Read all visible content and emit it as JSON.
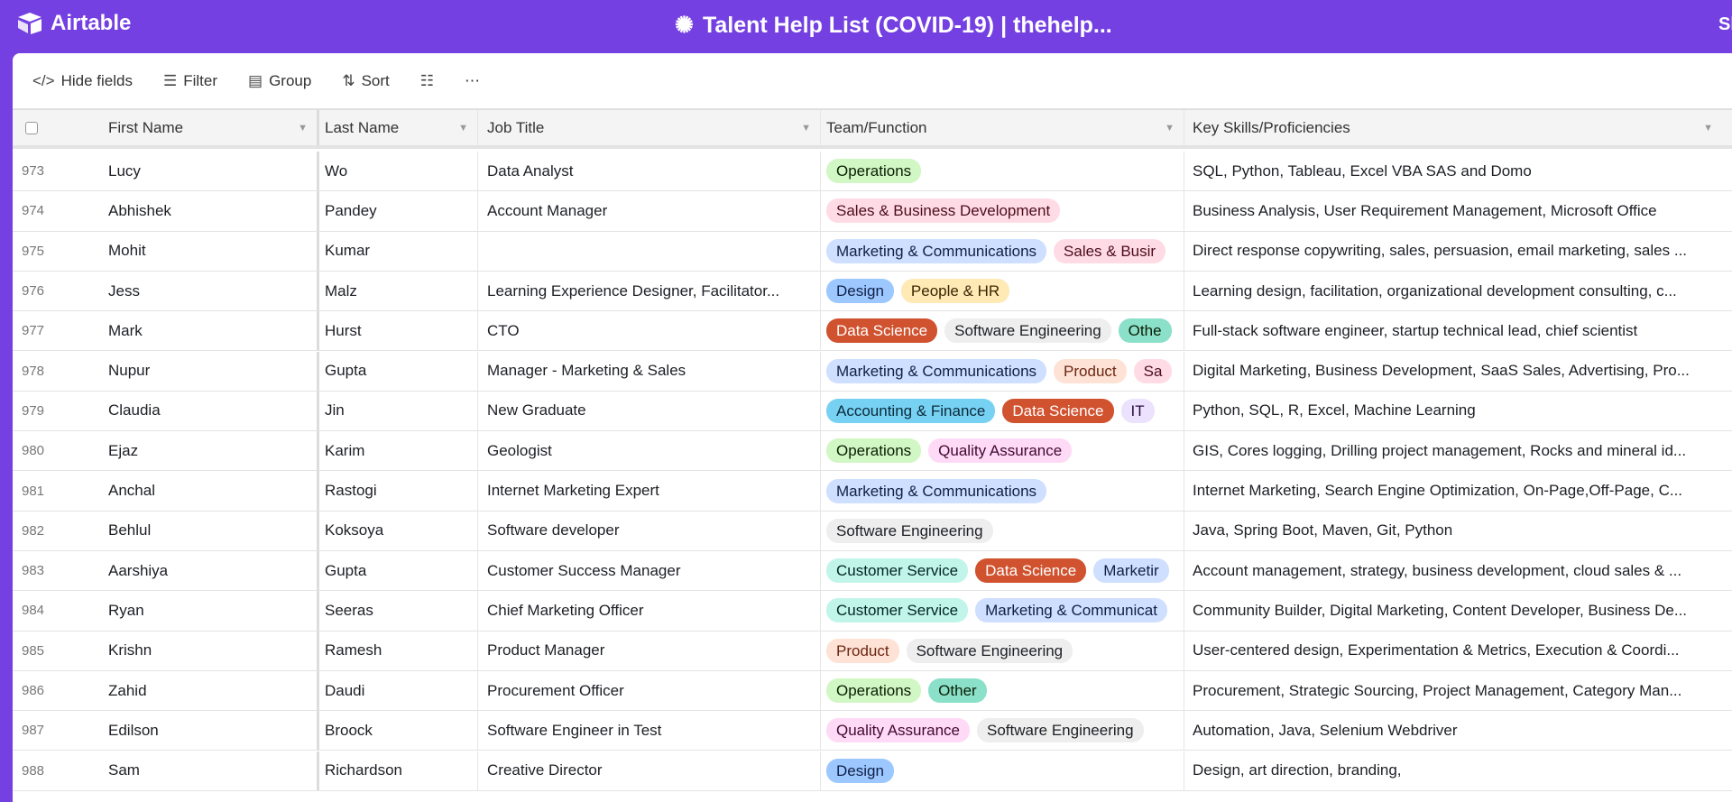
{
  "app": {
    "name": "Airtable",
    "title": "Talent Help List (COVID-19) | thehelp...",
    "share_label": "Sh"
  },
  "toolbar": {
    "hide_fields": "Hide fields",
    "filter": "Filter",
    "group": "Group",
    "sort": "Sort",
    "more": "⋯"
  },
  "columns": [
    "First Name",
    "Last Name",
    "Job Title",
    "Team/Function",
    "Key Skills/Proficiencies"
  ],
  "tag_colors": {
    "Operations": [
      "#d1f7c4",
      "#0b1d05"
    ],
    "Sales & Business Development": [
      "#ffdce5",
      "#4c0c1c"
    ],
    "Sales & Busir": [
      "#ffdce5",
      "#4c0c1c"
    ],
    "Sa": [
      "#ffdce5",
      "#4c0c1c"
    ],
    "Marketing & Communications": [
      "#cfdfff",
      "#102046"
    ],
    "Marketing & Communicat": [
      "#cfdfff",
      "#102046"
    ],
    "Marketir": [
      "#cfdfff",
      "#102046"
    ],
    "Design": [
      "#9cc7ff",
      "#102046"
    ],
    "People & HR": [
      "#ffeab6",
      "#3b2501"
    ],
    "Data Science": [
      "#d0522f",
      "#ffffff"
    ],
    "Software Engineering": [
      "#eeeeee",
      "#1d1f25"
    ],
    "Othe": [
      "#8ae0c9",
      "#0b1d05"
    ],
    "Other": [
      "#8ae0c9",
      "#0b1d05"
    ],
    "Product": [
      "#fee2d5",
      "#6b2613"
    ],
    "Accounting & Finance": [
      "#77d1f3",
      "#0b2a3a"
    ],
    "IT": [
      "#ede2fe",
      "#280b42"
    ],
    "Quality Assurance": [
      "#ffdaf6",
      "#400832"
    ],
    "Customer Service": [
      "#c2f5e9",
      "#012524"
    ]
  },
  "rows": [
    {
      "n": "973",
      "first": "Lucy",
      "last": "Wo",
      "job": "Data Analyst",
      "teams": [
        "Operations"
      ],
      "skills": "SQL, Python, Tableau, Excel VBA SAS and Domo"
    },
    {
      "n": "974",
      "first": "Abhishek",
      "last": "Pandey",
      "job": "Account Manager",
      "teams": [
        "Sales & Business Development"
      ],
      "skills": "Business Analysis, User Requirement Management, Microsoft Office"
    },
    {
      "n": "975",
      "first": "Mohit",
      "last": "Kumar",
      "job": "",
      "teams": [
        "Marketing & Communications",
        "Sales & Busir"
      ],
      "skills": "Direct response copywriting, sales, persuasion, email marketing, sales ..."
    },
    {
      "n": "976",
      "first": "Jess",
      "last": "Malz",
      "job": "Learning Experience Designer, Facilitator...",
      "teams": [
        "Design",
        "People & HR"
      ],
      "skills": "Learning design, facilitation, organizational development consulting, c..."
    },
    {
      "n": "977",
      "first": "Mark",
      "last": "Hurst",
      "job": "CTO",
      "teams": [
        "Data Science",
        "Software Engineering",
        "Othe"
      ],
      "skills": "Full-stack software engineer, startup technical lead, chief scientist"
    },
    {
      "n": "978",
      "first": "Nupur",
      "last": "Gupta",
      "job": "Manager - Marketing & Sales",
      "teams": [
        "Marketing & Communications",
        "Product",
        "Sa"
      ],
      "skills": "Digital Marketing, Business Development, SaaS Sales, Advertising, Pro..."
    },
    {
      "n": "979",
      "first": "Claudia",
      "last": "Jin",
      "job": "New Graduate",
      "teams": [
        "Accounting & Finance",
        "Data Science",
        "IT"
      ],
      "skills": "Python, SQL, R, Excel, Machine Learning"
    },
    {
      "n": "980",
      "first": "Ejaz",
      "last": "Karim",
      "job": "Geologist",
      "teams": [
        "Operations",
        "Quality Assurance"
      ],
      "skills": "GIS, Cores logging, Drilling project management, Rocks and mineral id..."
    },
    {
      "n": "981",
      "first": "Anchal",
      "last": "Rastogi",
      "job": "Internet Marketing Expert",
      "teams": [
        "Marketing & Communications"
      ],
      "skills": "Internet Marketing, Search Engine Optimization, On-Page,Off-Page, C..."
    },
    {
      "n": "982",
      "first": "Behlul",
      "last": "Koksoya",
      "job": "Software developer",
      "teams": [
        "Software Engineering"
      ],
      "skills": "Java, Spring Boot, Maven, Git, Python"
    },
    {
      "n": "983",
      "first": "Aarshiya",
      "last": "Gupta",
      "job": "Customer Success Manager",
      "teams": [
        "Customer Service",
        "Data Science",
        "Marketir"
      ],
      "skills": "Account management, strategy, business development, cloud sales & ..."
    },
    {
      "n": "984",
      "first": "Ryan",
      "last": "Seeras",
      "job": "Chief Marketing Officer",
      "teams": [
        "Customer Service",
        "Marketing & Communicat"
      ],
      "skills": "Community Builder, Digital Marketing, Content Developer, Business De..."
    },
    {
      "n": "985",
      "first": "Krishn",
      "last": "Ramesh",
      "job": "Product Manager",
      "teams": [
        "Product",
        "Software Engineering"
      ],
      "skills": "User-centered design, Experimentation & Metrics, Execution & Coordi..."
    },
    {
      "n": "986",
      "first": "Zahid",
      "last": "Daudi",
      "job": "Procurement Officer",
      "teams": [
        "Operations",
        "Other"
      ],
      "skills": "Procurement, Strategic Sourcing, Project Management, Category Man..."
    },
    {
      "n": "987",
      "first": "Edilson",
      "last": "Broock",
      "job": "Software Engineer in Test",
      "teams": [
        "Quality Assurance",
        "Software Engineering"
      ],
      "skills": "Automation, Java, Selenium Webdriver"
    },
    {
      "n": "988",
      "first": "Sam",
      "last": "Richardson",
      "job": "Creative Director",
      "teams": [
        "Design"
      ],
      "skills": "Design, art direction, branding,"
    }
  ]
}
